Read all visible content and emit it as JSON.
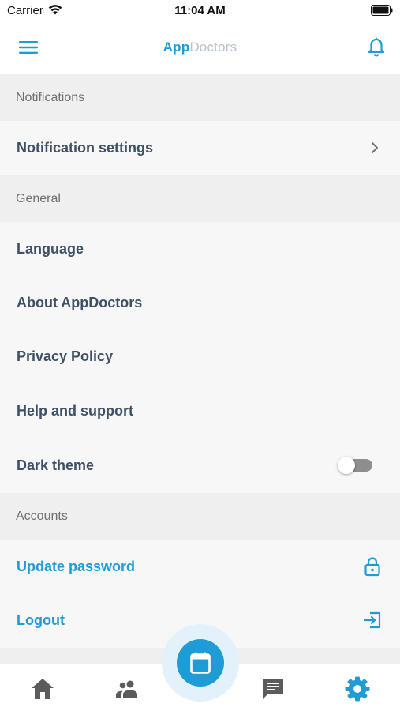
{
  "status_bar": {
    "carrier": "Carrier",
    "time": "11:04 AM"
  },
  "header": {
    "title_part1": "App",
    "title_part2": "Doctors",
    "accent_color": "#1f9bd6"
  },
  "sections": {
    "notifications": {
      "header": "Notifications",
      "items": [
        {
          "label": "Notification settings",
          "trailing": "chevron-right-icon"
        }
      ]
    },
    "general": {
      "header": "General",
      "items": [
        {
          "label": "Language"
        },
        {
          "label": "About AppDoctors"
        },
        {
          "label": "Privacy Policy"
        },
        {
          "label": "Help and support"
        },
        {
          "label": "Dark theme",
          "trailing": "toggle",
          "toggle_on": false
        }
      ]
    },
    "accounts": {
      "header": "Accounts",
      "items": [
        {
          "label": "Update password",
          "trailing": "lock-icon"
        },
        {
          "label": "Logout",
          "trailing": "logout-icon"
        }
      ]
    }
  },
  "tab_bar": {
    "items": [
      {
        "icon": "home-icon",
        "active": false
      },
      {
        "icon": "people-icon",
        "active": false
      },
      {
        "icon": "calendar-icon",
        "active": false,
        "center": true
      },
      {
        "icon": "chat-icon",
        "active": false
      },
      {
        "icon": "settings-gear-icon",
        "active": true
      }
    ],
    "active_color": "#1f9bd6",
    "inactive_color": "#5b5b5b"
  }
}
